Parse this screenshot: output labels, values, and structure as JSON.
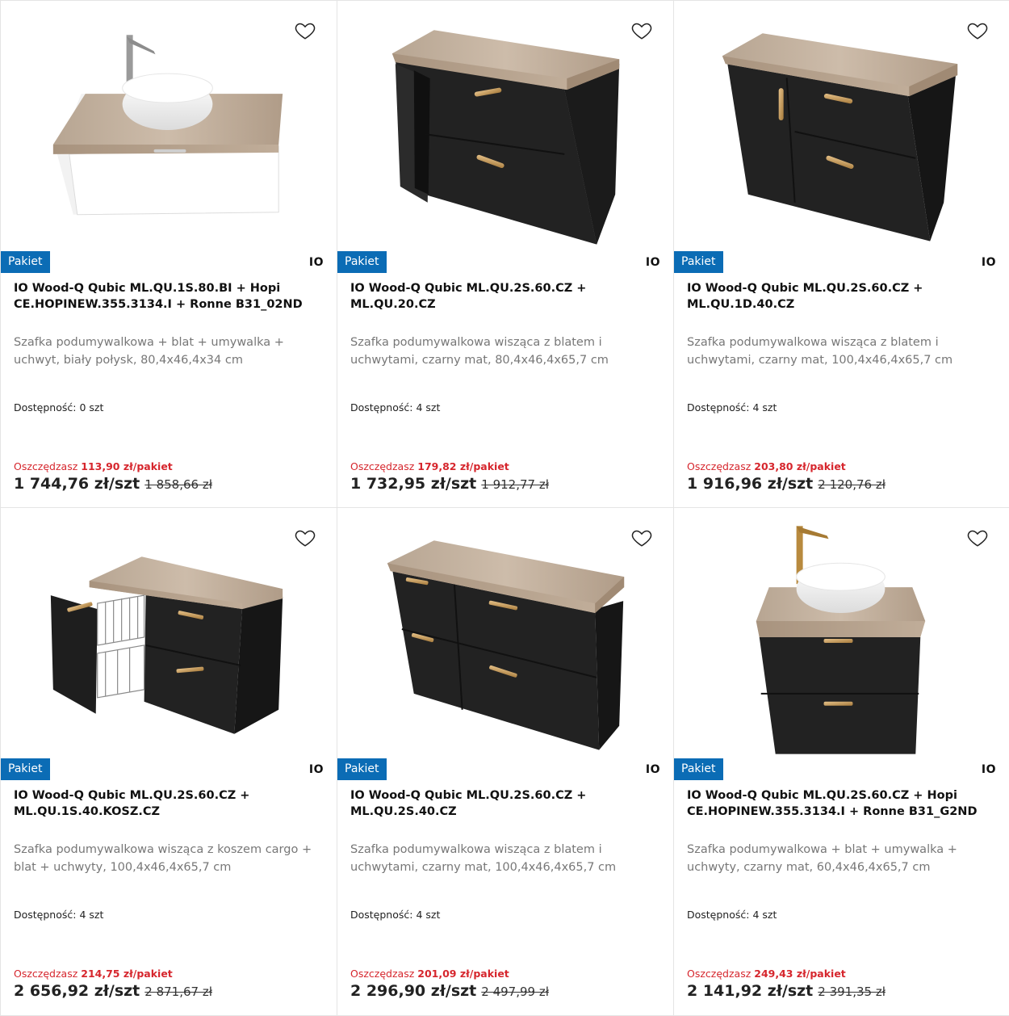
{
  "colors": {
    "badge": "#0b6cb5",
    "savings": "#d6262d"
  },
  "products": [
    {
      "badge": "Pakiet",
      "brand": "IO",
      "title": "IO Wood-Q Qubic ML.QU.1S.80.BI + Hopi CE.HOPINEW.355.3134.I + Ronne B31_02ND",
      "description": "Szafka podumywalkowa + blat + umywalka + uchwyt, biały połysk, 80,4x46,4x34 cm",
      "availability": "Dostępność: 0 szt",
      "savings_label": "Oszczędzasz",
      "savings_value": "113,90 zł/pakiet",
      "price": "1 744,76 zł/szt",
      "old_price": "1 858,66 zł",
      "image": "white-cabinet-with-basin"
    },
    {
      "badge": "Pakiet",
      "brand": "IO",
      "title": "IO Wood-Q Qubic ML.QU.2S.60.CZ + ML.QU.20.CZ",
      "description": "Szafka podumywalkowa wisząca z blatem i uchwytami, czarny mat, 80,4x46,4x65,7 cm",
      "availability": "Dostępność: 4 szt",
      "savings_label": "Oszczędzasz",
      "savings_value": "179,82 zł/pakiet",
      "price": "1 732,95 zł/szt",
      "old_price": "1 912,77 zł",
      "image": "black-cabinet-open-shelf"
    },
    {
      "badge": "Pakiet",
      "brand": "IO",
      "title": "IO Wood-Q Qubic ML.QU.2S.60.CZ + ML.QU.1D.40.CZ",
      "description": "Szafka podumywalkowa wisząca z blatem i uchwytami, czarny mat, 100,4x46,4x65,7 cm",
      "availability": "Dostępność: 4 szt",
      "savings_label": "Oszczędzasz",
      "savings_value": "203,80 zł/pakiet",
      "price": "1 916,96 zł/szt",
      "old_price": "2 120,76 zł",
      "image": "black-cabinet-door"
    },
    {
      "badge": "Pakiet",
      "brand": "IO",
      "title": "IO Wood-Q Qubic ML.QU.2S.60.CZ + ML.QU.1S.40.KOSZ.CZ",
      "description": "Szafka podumywalkowa wisząca z koszem cargo + blat + uchwyty, 100,4x46,4x65,7 cm",
      "availability": "Dostępność: 4 szt",
      "savings_label": "Oszczędzasz",
      "savings_value": "214,75 zł/pakiet",
      "price": "2 656,92 zł/szt",
      "old_price": "2 871,67 zł",
      "image": "black-cabinet-cargo"
    },
    {
      "badge": "Pakiet",
      "brand": "IO",
      "title": "IO Wood-Q Qubic ML.QU.2S.60.CZ + ML.QU.2S.40.CZ",
      "description": "Szafka podumywalkowa wisząca z blatem i uchwytami, czarny mat, 100,4x46,4x65,7 cm",
      "availability": "Dostępność: 4 szt",
      "savings_label": "Oszczędzasz",
      "savings_value": "201,09 zł/pakiet",
      "price": "2 296,90 zł/szt",
      "old_price": "2 497,99 zł",
      "image": "black-cabinet-four-drawers"
    },
    {
      "badge": "Pakiet",
      "brand": "IO",
      "title": "IO Wood-Q Qubic ML.QU.2S.60.CZ + Hopi CE.HOPINEW.355.3134.I + Ronne B31_G2ND",
      "description": "Szafka podumywalkowa + blat + umywalka + uchwyty, czarny mat, 60,4x46,4x65,7 cm",
      "availability": "Dostępność: 4 szt",
      "savings_label": "Oszczędzasz",
      "savings_value": "249,43 zł/pakiet",
      "price": "2 141,92 zł/szt",
      "old_price": "2 391,35 zł",
      "image": "black-cabinet-with-basin"
    }
  ]
}
